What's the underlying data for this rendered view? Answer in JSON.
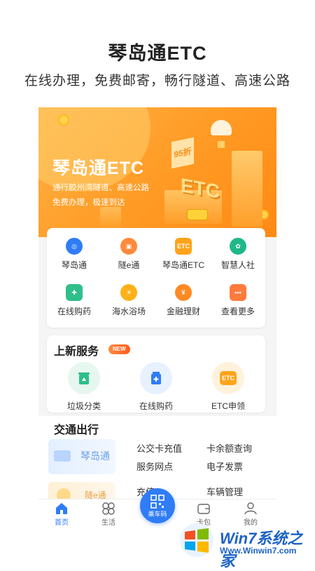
{
  "promo": {
    "title": "琴岛通ETC",
    "subtitle": "在线办理，免费邮寄，畅行隧道、高速公路"
  },
  "banner": {
    "title": "琴岛通ETC",
    "line1": "通行胶州湾隧道、高速公路",
    "line2": "免费办理，极速到达",
    "discount_tag": "95折",
    "etc_text": "ETC"
  },
  "grid": [
    {
      "label": "琴岛通",
      "icon": "qindaotong-logo-icon",
      "color": "#2f7cf6"
    },
    {
      "label": "隧e通",
      "icon": "tunnel-icon",
      "color": "#ff8a3d"
    },
    {
      "label": "琴岛通ETC",
      "icon": "etc-icon",
      "color": "#ffa31a",
      "icon_text": "ETC"
    },
    {
      "label": "智慧人社",
      "icon": "social-icon",
      "color": "#1fb889"
    },
    {
      "label": "在线购药",
      "icon": "medicine-icon",
      "color": "#2fbf8a"
    },
    {
      "label": "海水浴场",
      "icon": "beach-icon",
      "color": "#ffb11a"
    },
    {
      "label": "金融理财",
      "icon": "money-bag-icon",
      "color": "#ff8a24"
    },
    {
      "label": "查看更多",
      "icon": "more-icon",
      "color": "#ff7a3d"
    }
  ],
  "new_services": {
    "title": "上新服务",
    "badge": "NEW",
    "items": [
      {
        "label": "垃圾分类",
        "icon": "trash-icon"
      },
      {
        "label": "在线购药",
        "icon": "medicine-icon"
      },
      {
        "label": "ETC申领",
        "icon": "etc-icon",
        "icon_text": "ETC"
      }
    ]
  },
  "traffic": {
    "title": "交通出行",
    "card_text": "琴岛通",
    "card2_text": "隧e通",
    "links": [
      "公交卡充值",
      "卡余额查询",
      "服务网点",
      "电子发票",
      "充值",
      "车辆管理"
    ]
  },
  "tabbar": {
    "items": [
      {
        "label": "首页",
        "icon": "home-icon"
      },
      {
        "label": "生活",
        "icon": "life-icon"
      },
      {
        "label": "乘车码",
        "icon": "qr-code-icon"
      },
      {
        "label": "卡包",
        "icon": "wallet-icon"
      },
      {
        "label": "我的",
        "icon": "user-icon"
      }
    ]
  },
  "watermark": {
    "text": "Win7系统之家",
    "url": "Www.Winwin7.com"
  },
  "colors": {
    "primary": "#2f7cf6",
    "banner": "#ff9a24"
  }
}
